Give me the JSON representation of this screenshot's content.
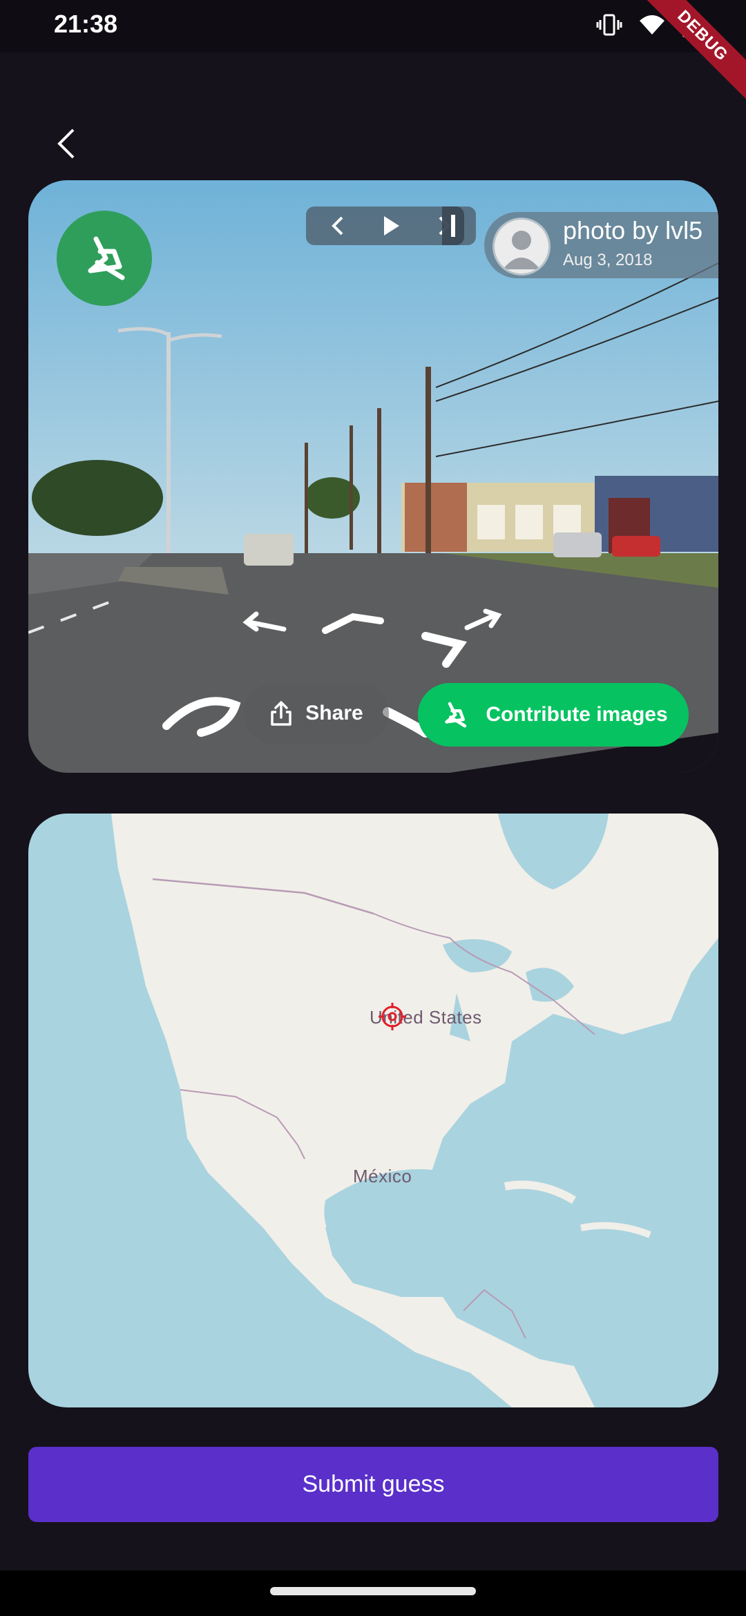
{
  "status_bar": {
    "time": "21:38",
    "icons": [
      "vibrate-icon",
      "wifi-icon",
      "battery-icon"
    ],
    "debug_banner": "DEBUG"
  },
  "nav": {
    "back_icon": "chevron-left-icon"
  },
  "street_view": {
    "player_controls": [
      "chevron-left-icon",
      "play-icon",
      "chevron-right-icon",
      "stop-bar-icon"
    ],
    "attribution": {
      "name": "photo by lvl5",
      "date": "Aug 3, 2018"
    },
    "share_label": "Share",
    "contribute_label": "Contribute images",
    "accent": "#07c261"
  },
  "map": {
    "labels": {
      "usa": "United States",
      "mexico": "México"
    },
    "marker_icon": "target-icon",
    "marker_color": "#e0202a"
  },
  "submit_label": "Submit guess",
  "colors": {
    "submit": "#5a2fca",
    "background": "#15121b"
  }
}
